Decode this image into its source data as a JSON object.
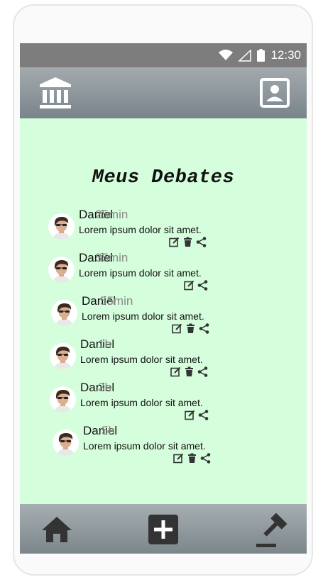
{
  "status_bar": {
    "time": "12:30",
    "icons": [
      "wifi-icon",
      "signal-icon",
      "battery-icon"
    ]
  },
  "app_bar": {
    "left_icon": "bank-icon",
    "right_icon": "profile-icon"
  },
  "page": {
    "title": "Meus Debates"
  },
  "debates": [
    {
      "author": "Daniel",
      "time": "25min",
      "text": "Lorem ipsum dolor sit amet.",
      "actions": [
        "edit",
        "delete",
        "share"
      ]
    },
    {
      "author": "Daniel",
      "time": "35min",
      "text": "Lorem ipsum dolor sit amet.",
      "actions": [
        "edit",
        "share"
      ]
    },
    {
      "author": "Daniel",
      "time": "55min",
      "text": "Lorem ipsum dolor sit amet.",
      "actions": [
        "edit",
        "delete",
        "share"
      ]
    },
    {
      "author": "Daniel",
      "time": "1h",
      "text": "Lorem ipsum dolor sit amet.",
      "actions": [
        "edit",
        "delete",
        "share"
      ]
    },
    {
      "author": "Daniel",
      "time": "3h",
      "text": "Lorem ipsum dolor sit amet.",
      "actions": [
        "edit",
        "share"
      ]
    },
    {
      "author": "Daniel",
      "time": "5h",
      "text": "Lorem ipsum dolor sit amet.",
      "actions": [
        "edit",
        "delete",
        "share"
      ]
    }
  ],
  "bottom_nav": [
    "home-icon",
    "add-icon",
    "gavel-icon"
  ],
  "colors": {
    "content_bg": "#d5fedc",
    "appbar": "#8a959a",
    "statusbar": "#7d7d7d",
    "icon": "#333333"
  }
}
